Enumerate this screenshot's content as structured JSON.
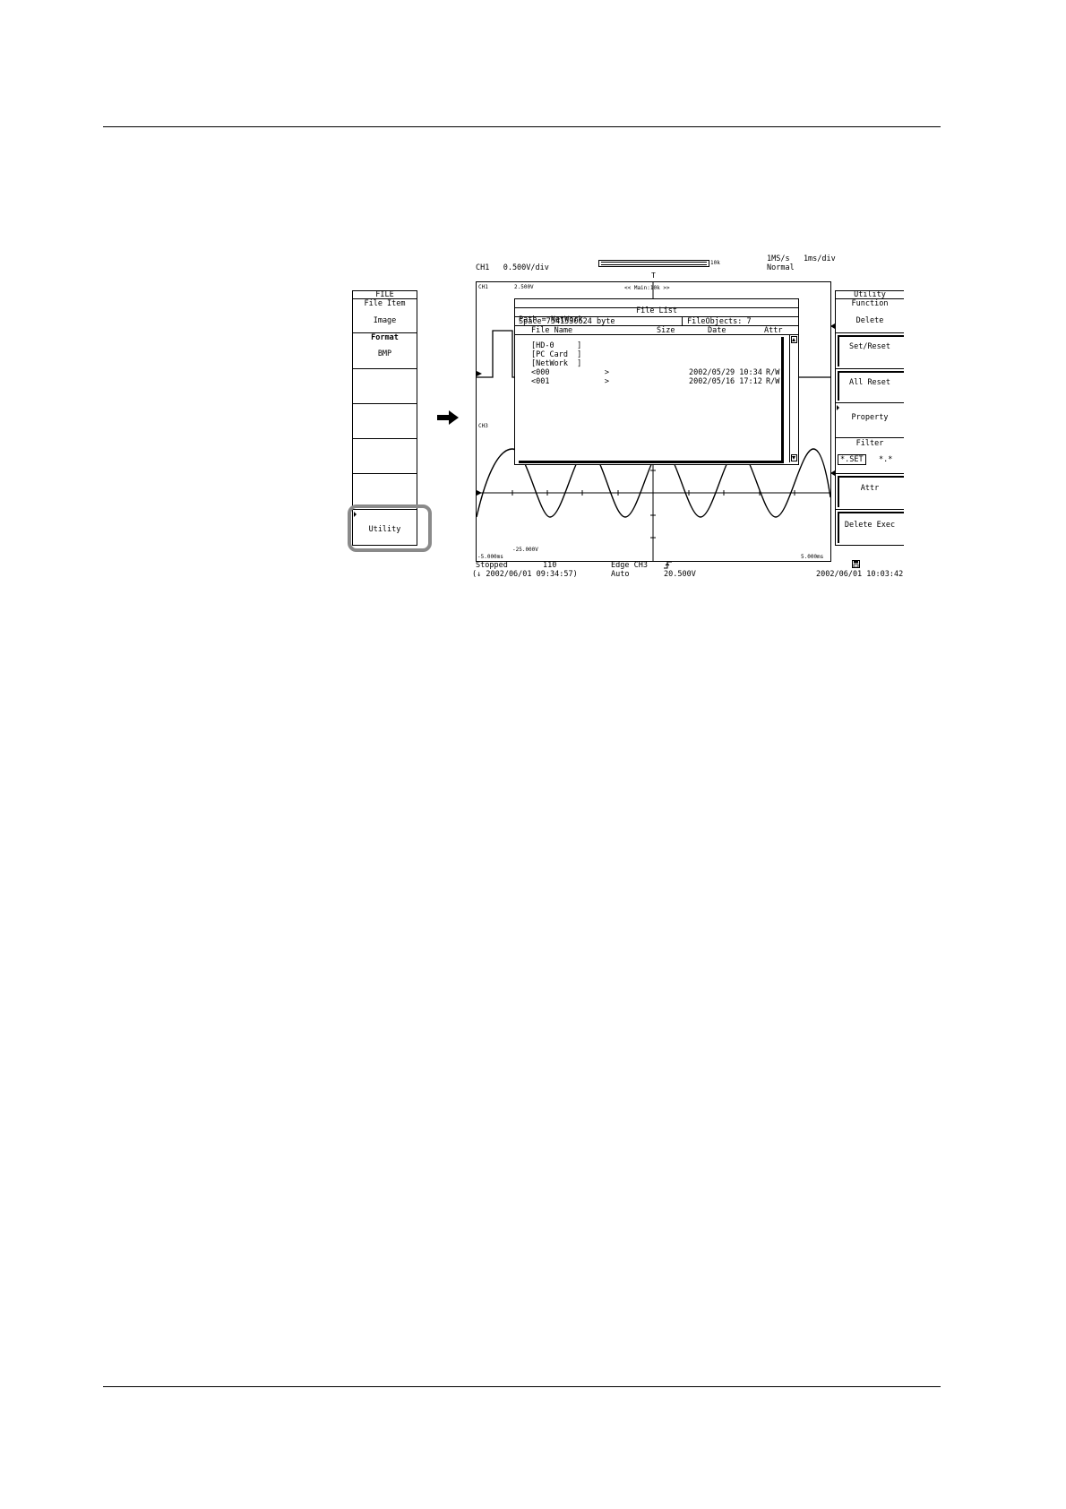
{
  "header": {
    "ch1_scale": "CH1   0.500V/div",
    "sample_rate": "1MS/s   1ms/div",
    "acq_mode": "Normal",
    "zoom_label": "<< Main:10k >>",
    "record_label": "10k",
    "trigger_marker": "T"
  },
  "screen": {
    "ch1_label": "CH1",
    "ch1_level": "2.500V",
    "ch3_label": "CH3",
    "ch3_level": "-25.000V",
    "t_left": "-5.000ms",
    "t_right": "5.000ms"
  },
  "left_menu": {
    "title": "FILE",
    "file_item_label": "File Item",
    "file_item_value": "Image",
    "format_label": "Format",
    "format_value": "BMP",
    "utility": "Utility"
  },
  "right_menu": {
    "title": "Utility",
    "function_label": "Function",
    "function_value": "Delete",
    "set_reset": "Set/Reset",
    "all_reset": "All Reset",
    "property": "Property",
    "filter_label": "Filter",
    "filter_opt1": "*.SET",
    "filter_opt2": "*.*",
    "attr": "Attr",
    "delete_exec": "Delete Exec"
  },
  "file_list": {
    "title": "File List",
    "path": "Path = NetWork",
    "space": "Space 7541530624 byte",
    "objects": "FileObjects: 7",
    "columns": [
      "File Name",
      "Size",
      "Date",
      "Attr"
    ],
    "entries": [
      {
        "name": "[HD-0     ]",
        "date": "",
        "attr": ""
      },
      {
        "name": "[PC Card  ]",
        "date": "",
        "attr": ""
      },
      {
        "name": "[NetWork  ]",
        "date": "",
        "attr": ""
      },
      {
        "name": "<000            >",
        "date": "2002/05/29 10:34",
        "attr": "R/W"
      },
      {
        "name": "<001            >",
        "date": "2002/05/16 17:12",
        "attr": "R/W"
      }
    ]
  },
  "status": {
    "state": "Stopped",
    "count": "110",
    "trigger": "Edge CH3",
    "slope_icon": "rising-edge-icon",
    "trig_level": "20.500V",
    "trig_mode": "Auto",
    "start_time": "(↓ 2002/06/01 09:34:57)",
    "clock": "2002/06/01 10:03:42",
    "storage_icon": "floppy-icon"
  }
}
